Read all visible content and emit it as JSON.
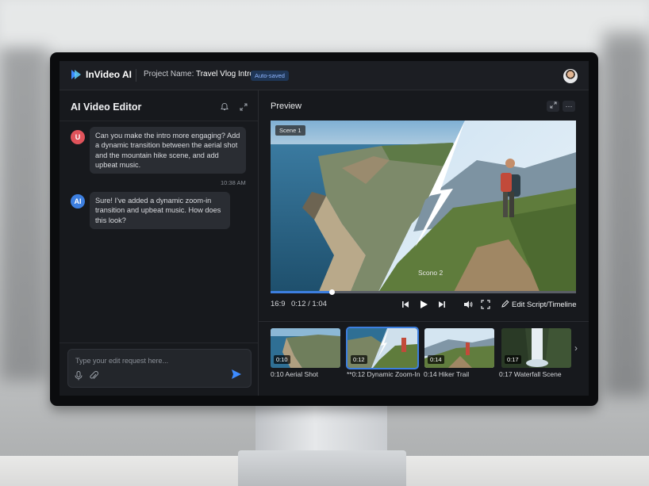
{
  "app": {
    "logo_text": "InVideo AI",
    "project_label": "Project Name:",
    "project_name": "Travel Vlog Intro",
    "autosave_badge": "Auto-saved",
    "accent_color": "#3d7fe0"
  },
  "left_panel": {
    "title": "AI Video Editor",
    "header_icons": [
      "bell-icon",
      "expand-icon"
    ],
    "messages": [
      {
        "sender_initial": "U",
        "avatar_color": "#e0535b",
        "text": "Can you make the intro more engaging? Add a dynamic transition between the aerial shot and the mountain hike scene, and add upbeat music.",
        "time": "10:38 AM"
      },
      {
        "sender_initial": "AI",
        "avatar_color": "#3d7fe0",
        "text": "Sure! I've added a dynamic zoom-in transition and upbeat music. How does this look?"
      }
    ],
    "input_placeholder": "Type your edit request here...",
    "input_icons": [
      "microphone-icon",
      "paperclip-icon",
      "send-icon"
    ]
  },
  "preview": {
    "title": "Preview",
    "header_icons": [
      "expand-icon",
      "more-icon"
    ],
    "scene1_tag": "Scene 1",
    "scene2_label": "Scono 2",
    "progress_fraction": 0.2,
    "aspect_ratio": "16:9",
    "time": "0:12 / 1:04",
    "controls": [
      "skip-back-icon",
      "play-icon",
      "skip-forward-icon",
      "volume-icon",
      "fullscreen-icon"
    ],
    "edit_button": "Edit Script/Timeline"
  },
  "timeline": {
    "clips": [
      {
        "time": "0:10",
        "label": "0:10 Aerial Shot",
        "selected": false
      },
      {
        "time": "0:12",
        "label": "**0:12 Dynamic Zoom-In",
        "selected": true
      },
      {
        "time": "0:14",
        "label": "0:14 Hiker Trail",
        "selected": false
      },
      {
        "time": "0:17",
        "label": "0:17 Waterfall Scene",
        "selected": false
      }
    ],
    "next_icon": "chevron-right-icon"
  }
}
